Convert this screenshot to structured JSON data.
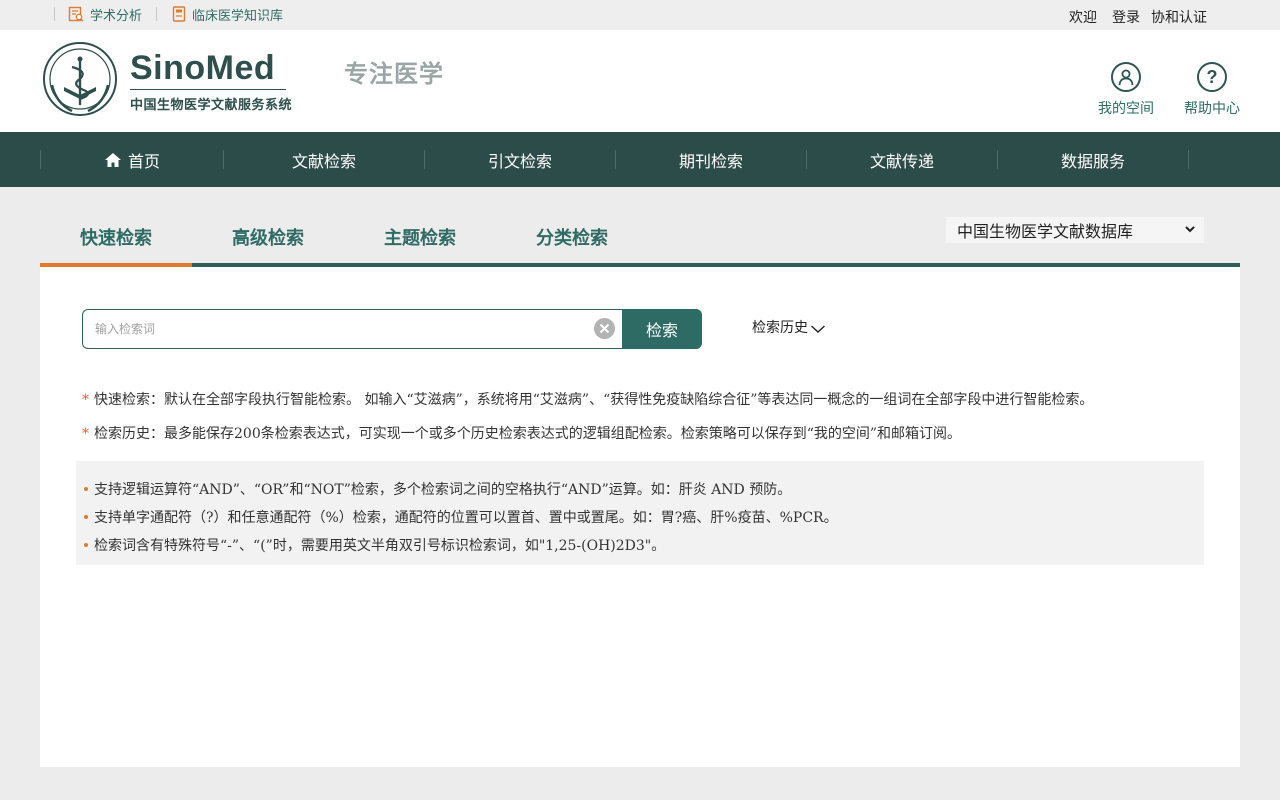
{
  "topbar": {
    "links": [
      {
        "label": "学术分析",
        "icon": "report-icon"
      },
      {
        "label": "临床医学知识库",
        "icon": "book-icon"
      }
    ],
    "welcome": "欢迎",
    "login": "登录",
    "auth": "协和认证"
  },
  "header": {
    "logo_title": "SinoMed",
    "logo_subtitle": "中国生物医学文献服务系统",
    "emblem_text": "IMI.CAMS",
    "slogan": "专注医学",
    "my_space": "我的空间",
    "help_center": "帮助中心"
  },
  "nav": {
    "items": [
      "首页",
      "文献检索",
      "引文检索",
      "期刊检索",
      "文献传递",
      "数据服务"
    ]
  },
  "tabs": {
    "items": [
      "快速检索",
      "高级检索",
      "主题检索",
      "分类检索"
    ],
    "active": 0
  },
  "database": {
    "selected": "中国生物医学文献数据库"
  },
  "search": {
    "placeholder": "输入检索词",
    "button": "检索",
    "history": "检索历史"
  },
  "notes": [
    {
      "star": "*",
      "text": "快速检索：默认在全部字段执行智能检索。 如输入“艾滋病”，系统将用“艾滋病”、“获得性免疫缺陷综合征”等表达同一概念的一组词在全部字段中进行智能检索。"
    },
    {
      "star": "*",
      "text": "检索历史：最多能保存200条检索表达式，可实现一个或多个历史检索表达式的逻辑组配检索。检索策略可以保存到“我的空间”和邮箱订阅。"
    }
  ],
  "tips": [
    "支持逻辑运算符“AND”、“OR”和“NOT”检索，多个检索词之间的空格执行“AND”运算。如：肝炎 AND 预防。",
    "支持单字通配符（?）和任意通配符（%）检索，通配符的位置可以置首、置中或置尾。如：胃?癌、肝%疫苗、%PCR。",
    "检索词含有特殊符号“-”、“(”时，需要用英文半角双引号标识检索词，如\"1,25-(OH)2D3\"。"
  ],
  "colors": {
    "nav_bg": "#2c4c49",
    "accent_teal": "#2e6b65",
    "accent_orange": "#e07a2e"
  }
}
